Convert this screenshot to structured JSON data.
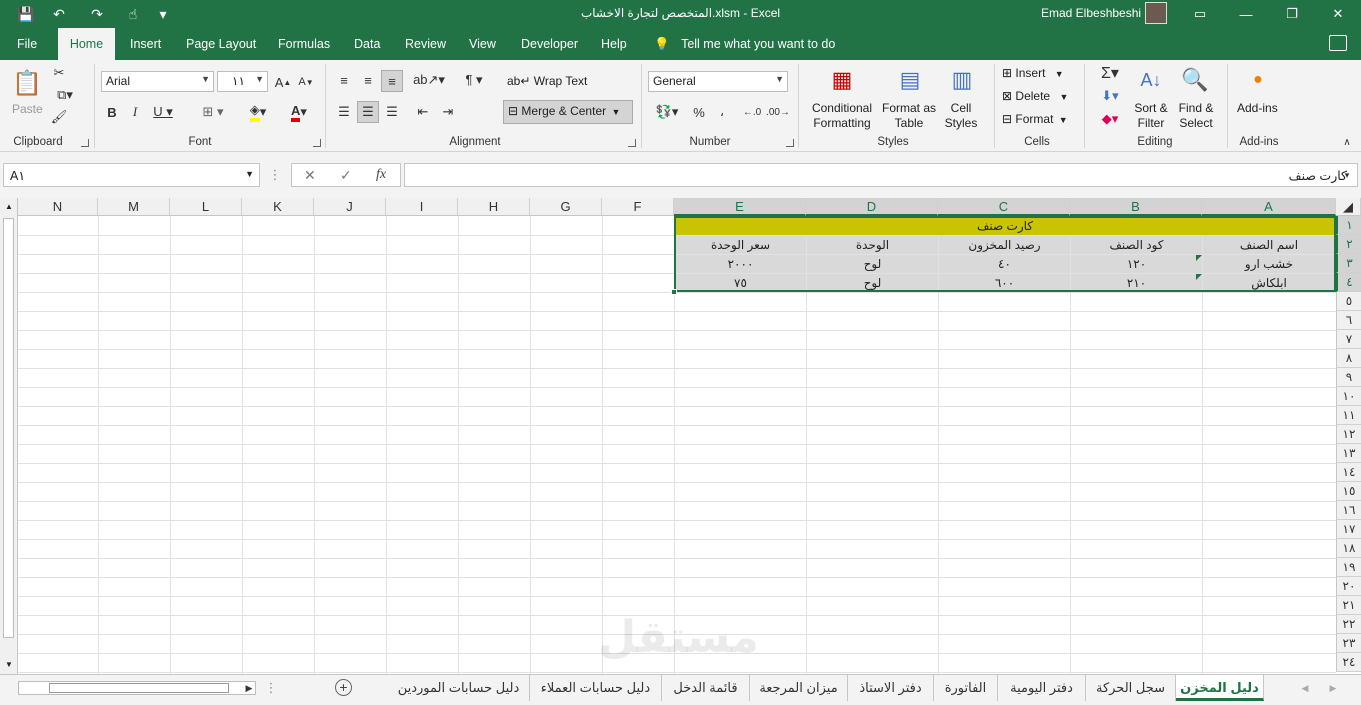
{
  "window": {
    "title": "المتخصص لتجارة الاخشاب.xlsm  -  Excel",
    "user": "Emad Elbeshbeshi"
  },
  "tabs": [
    "File",
    "Home",
    "Insert",
    "Page Layout",
    "Formulas",
    "Data",
    "Review",
    "View",
    "Developer",
    "Help"
  ],
  "active_tab": "Home",
  "tell_me": "Tell me what you want to do",
  "ribbon": {
    "clipboard": {
      "paste": "Paste",
      "label": "Clipboard"
    },
    "font": {
      "name": "Arial",
      "size": "١١",
      "label": "Font"
    },
    "alignment": {
      "wrap_text": "Wrap Text",
      "merge_center": "Merge & Center",
      "label": "Alignment"
    },
    "number": {
      "format": "General",
      "label": "Number"
    },
    "styles": {
      "conditional_1": "Conditional",
      "conditional_2": "Formatting",
      "format_as_1": "Format as",
      "format_as_2": "Table",
      "cell_styles_1": "Cell",
      "cell_styles_2": "Styles",
      "label": "Styles"
    },
    "cells": {
      "insert": "Insert",
      "delete": "Delete",
      "format": "Format",
      "label": "Cells"
    },
    "editing": {
      "sort_1": "Sort &",
      "sort_2": "Filter",
      "find_1": "Find &",
      "find_2": "Select",
      "label": "Editing"
    },
    "addins": {
      "button": "Add-ins",
      "label": "Add-ins"
    }
  },
  "formula_bar": {
    "name_box": "A١",
    "content": "كارت صنف"
  },
  "columns": [
    "A",
    "B",
    "C",
    "D",
    "E",
    "F",
    "G",
    "H",
    "I",
    "J",
    "K",
    "L",
    "M",
    "N"
  ],
  "rows": [
    "١",
    "٢",
    "٣",
    "٤",
    "٥",
    "٦",
    "٧",
    "٨",
    "٩",
    "١٠",
    "١١",
    "١٢",
    "١٣",
    "١٤",
    "١٥",
    "١٦",
    "١٧",
    "١٨",
    "١٩",
    "٢٠",
    "٢١",
    "٢٢",
    "٢٣",
    "٢٤"
  ],
  "sheet": {
    "title": "كارت صنف",
    "headers": [
      "اسم الصنف",
      "كود الصنف",
      "رصيد المخزون",
      "الوحدة",
      "سعر الوحدة"
    ],
    "rows": [
      [
        "خشب ارو",
        "١٢٠",
        "٤٠",
        "لوح",
        "٢٠٠٠"
      ],
      [
        "ابلكاش",
        "٢١٠",
        "٦٠٠",
        "لوح",
        "٧٥"
      ]
    ]
  },
  "sheet_tabs": [
    "دليل المخزن",
    "سجل الحركة",
    "دفتر اليومية",
    "الفاتورة",
    "دفتر الاستاذ",
    "ميزان المرجعة",
    "قائمة الدخل",
    "دليل حسابات العملاء",
    "دليل حسابات الموردين"
  ],
  "active_sheet": "دليل المخزن",
  "colors": {
    "accent": "#217346",
    "title_fill": "#c9c400",
    "header_fill": "#d9d9d9"
  }
}
